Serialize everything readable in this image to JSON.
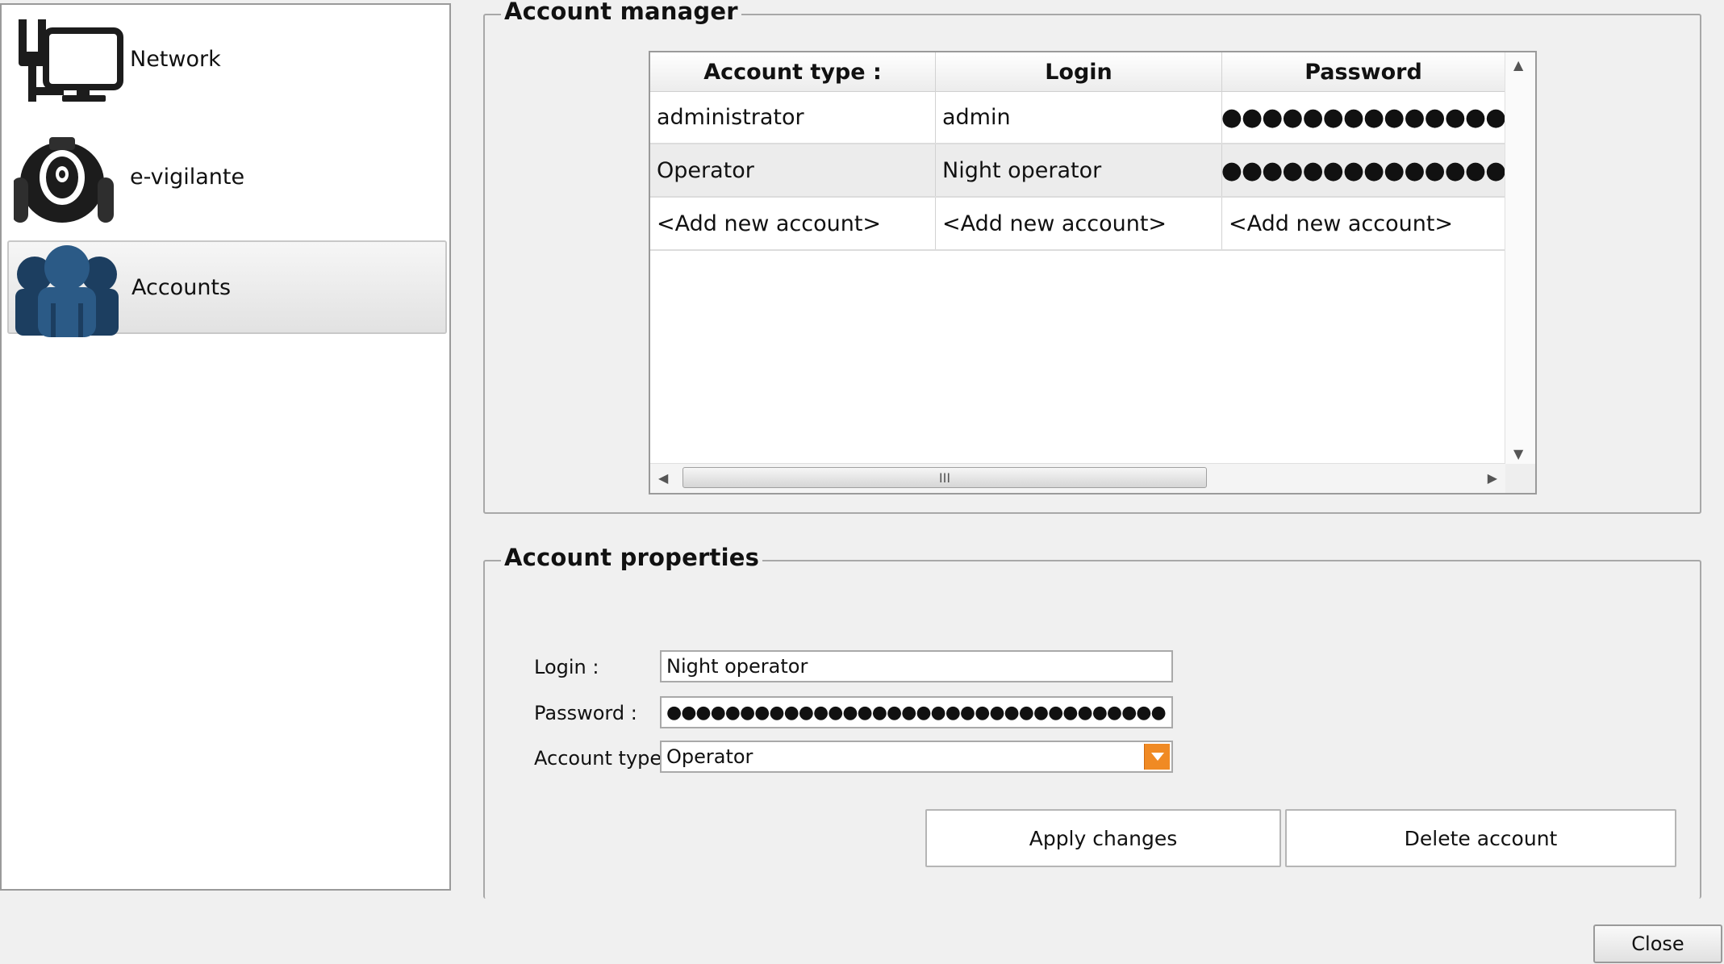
{
  "sidebar": {
    "items": [
      {
        "label": "Network",
        "icon": "network-computer-icon"
      },
      {
        "label": "e-vigilante",
        "icon": "robot-camera-icon"
      },
      {
        "label": "Accounts",
        "icon": "users-icon",
        "selected": true
      }
    ]
  },
  "account_manager": {
    "title": "Account manager",
    "columns": [
      "Account type :",
      "Login",
      "Password"
    ],
    "rows": [
      [
        "administrator",
        "admin",
        "●●●●●●●●●●●●●●●●"
      ],
      [
        "Operator",
        "Night operator",
        "●●●●●●●●●●●●●●●●"
      ],
      [
        "<Add new account>",
        "<Add new account>",
        "<Add new account>"
      ]
    ],
    "scroll_thumb_glyph": "III"
  },
  "account_properties": {
    "title": "Account properties",
    "login_label": "Login :",
    "login_value": "Night operator",
    "password_label": "Password :",
    "password_value": "●●●●●●●●●●●●●●●●●●●●●●●●●●●●●●●●●●",
    "account_type_label": "Account type",
    "account_type_value": "Operator",
    "apply_label": "Apply changes",
    "delete_label": "Delete account"
  },
  "footer": {
    "close_label": "Close"
  },
  "colors": {
    "accent_orange": "#f08a24",
    "icon_dark": "#1c1c1c",
    "icon_blue": "#2b5a86"
  }
}
